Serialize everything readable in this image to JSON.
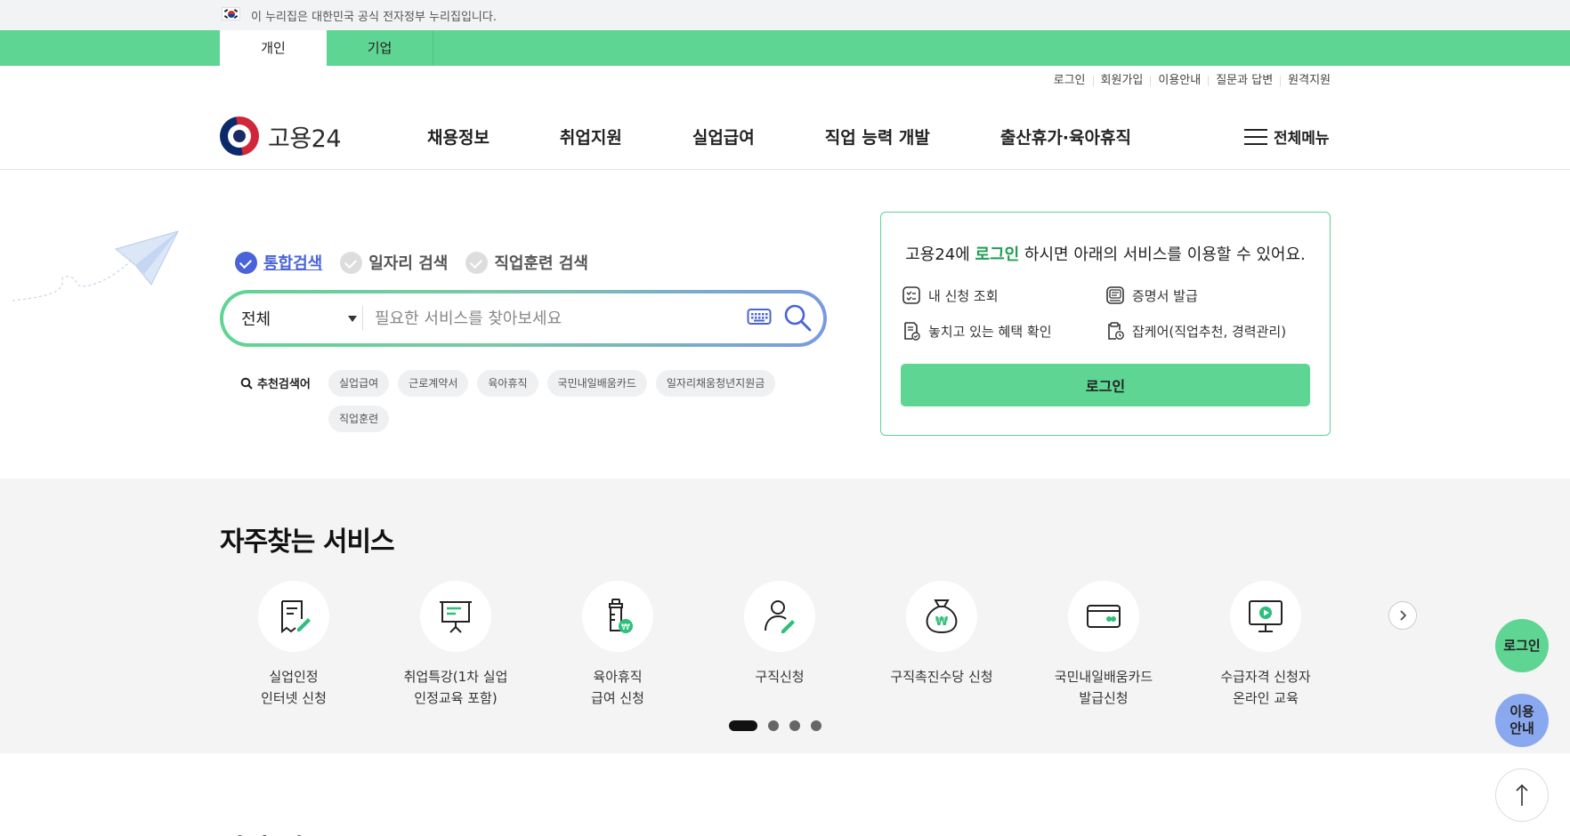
{
  "gov_banner": {
    "text": "이 누리집은 대한민국 공식 전자정부 누리집입니다."
  },
  "member_tabs": [
    {
      "label": "개인",
      "active": true
    },
    {
      "label": "기업",
      "active": false
    }
  ],
  "util_links": [
    "로그인",
    "회원가입",
    "이용안내",
    "질문과 답변",
    "원격지원"
  ],
  "header": {
    "logo_text": "고용24",
    "nav": [
      "채용정보",
      "취업지원",
      "실업급여",
      "직업 능력 개발",
      "출산휴가·육아휴직"
    ],
    "all_menu": "전체메뉴"
  },
  "search": {
    "tabs": [
      {
        "label": "통합검색",
        "active": true
      },
      {
        "label": "일자리 검색",
        "active": false
      },
      {
        "label": "직업훈련 검색",
        "active": false
      }
    ],
    "select_value": "전체",
    "placeholder": "필요한 서비스를 찾아보세요",
    "recommend_title": "추천검색어",
    "recommend": [
      "실업급여",
      "근로계약서",
      "육아휴직",
      "국민내일배움카드",
      "일자리채움청년지원금",
      "직업훈련"
    ]
  },
  "login_card": {
    "msg_pre": "고용24에 ",
    "msg_highlight": "로그인",
    "msg_post": " 하시면 아래의 서비스를 이용할 수 있어요.",
    "services": [
      "내 신청 조회",
      "증명서 발급",
      "놓치고 있는 혜택 확인",
      "잡케어(직업추천, 경력관리)"
    ],
    "button": "로그인"
  },
  "frequent": {
    "title": "자주찾는 서비스",
    "items": [
      {
        "label": "실업인정\n인터넷 신청",
        "icon": "document-pen-icon"
      },
      {
        "label": "취업특강(1차 실업\n인정교육 포함)",
        "icon": "presentation-board-icon"
      },
      {
        "label": "육아휴직\n급여 신청",
        "icon": "baby-bottle-icon"
      },
      {
        "label": "구직신청",
        "icon": "person-pen-icon"
      },
      {
        "label": "구직촉진수당 신청",
        "icon": "money-bag-icon"
      },
      {
        "label": "국민내일배움카드\n발급신청",
        "icon": "card-icon"
      },
      {
        "label": "수급자격 신청자\n온라인 교육",
        "icon": "monitor-play-icon"
      }
    ],
    "page_count": 4,
    "active_page": 1
  },
  "next_section_title": "기업 패쿠",
  "floating": {
    "login": "로그인",
    "guide": "이용\n안내"
  },
  "colors": {
    "brand_green": "#5ed592",
    "accent_blue": "#4a63d8",
    "highlight_green": "#1f9d55"
  }
}
